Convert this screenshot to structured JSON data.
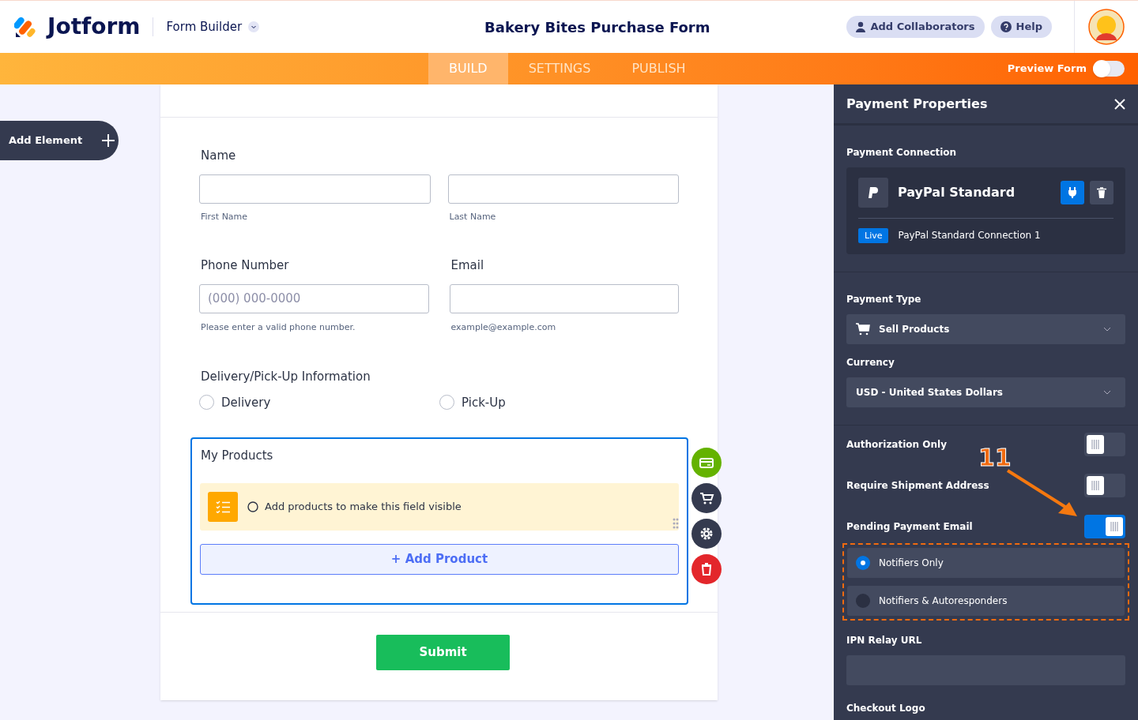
{
  "header": {
    "logo_text": "Jotform",
    "app_menu": "Form Builder",
    "form_title": "Bakery Bites Purchase Form",
    "buttons": [
      {
        "kind": "collaborators",
        "label": "Add Collaborators"
      },
      {
        "kind": "help",
        "label": "Help"
      }
    ]
  },
  "nav_tabs": [
    {
      "label": "BUILD",
      "selected": true
    },
    {
      "label": "SETTINGS",
      "selected": false
    },
    {
      "label": "PUBLISH",
      "selected": false
    }
  ],
  "preview_form": {
    "label": "Preview Form",
    "on": false
  },
  "add_element": {
    "label": "Add Element"
  },
  "form": {
    "name": {
      "label": "Name",
      "subfields": [
        "First Name",
        "Last Name"
      ]
    },
    "phone": {
      "label": "Phone Number",
      "placeholder": "(000) 000-0000",
      "hint": "Please enter a valid phone number."
    },
    "email": {
      "label": "Email",
      "hint": "example@example.com"
    },
    "delivery": {
      "label": "Delivery/Pick-Up Information",
      "options": [
        {
          "label": "Delivery",
          "selected": false
        },
        {
          "label": "Pick-Up",
          "selected": false
        }
      ]
    },
    "products": {
      "label": "My Products",
      "notice": "Add products to make this field visible",
      "add_button": "+ Add Product"
    },
    "submit": "Submit"
  },
  "panel": {
    "title": "Payment Properties",
    "connection_label": "Payment Connection",
    "gateway": "PayPal Standard",
    "status": "Live",
    "connection_name": "PayPal Standard Connection 1",
    "payment_type": {
      "label": "Payment Type",
      "value": "Sell Products"
    },
    "currency": {
      "label": "Currency",
      "value": "USD - United States Dollars"
    },
    "toggles": [
      {
        "label": "Authorization Only",
        "on": false
      },
      {
        "label": "Require Shipment Address",
        "on": false
      },
      {
        "label": "Pending Payment Email",
        "on": true
      }
    ],
    "email_options": [
      {
        "label": "Notifiers Only",
        "selected": true
      },
      {
        "label": "Notifiers & Autoresponders",
        "selected": false
      }
    ],
    "ipn_label": "IPN Relay URL",
    "checkout_logo_label": "Checkout Logo"
  },
  "annotation": {
    "step": "11"
  }
}
